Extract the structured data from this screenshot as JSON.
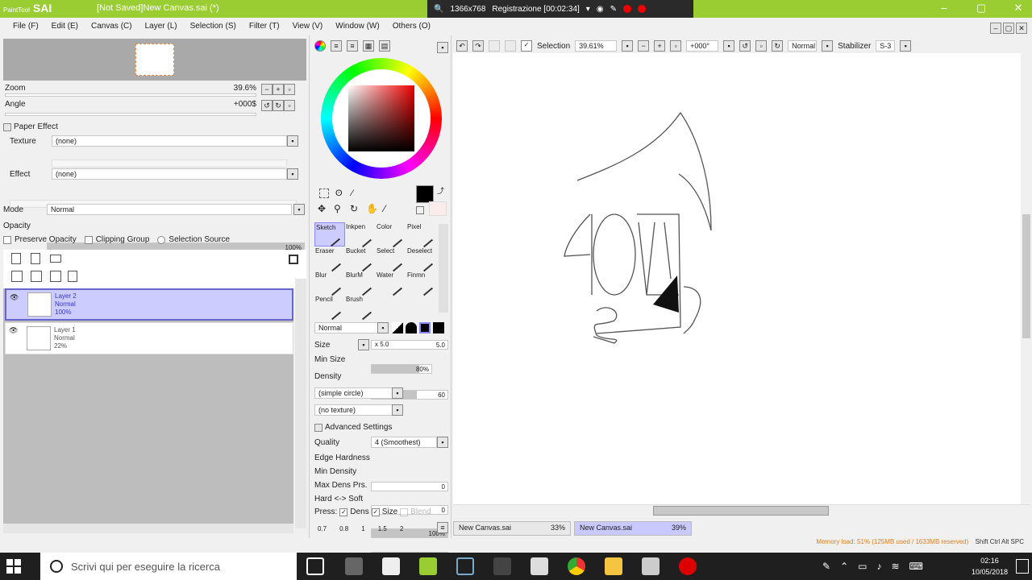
{
  "titlebar": {
    "logo_small": "PaintTool",
    "logo_big": "SAI",
    "title": "[Not Saved]New Canvas.sai (*)",
    "minimize": "–",
    "maximize": "▢",
    "close": "✕"
  },
  "recorder": {
    "resolution": "1366x768",
    "status": "Registrazione [00:02:34]"
  },
  "menu": [
    "File (F)",
    "Edit (E)",
    "Canvas (C)",
    "Layer (L)",
    "Selection (S)",
    "Filter (T)",
    "View (V)",
    "Window (W)",
    "Others (O)"
  ],
  "navigator": {
    "zoom_label": "Zoom",
    "zoom_value": "39.6%",
    "angle_label": "Angle",
    "angle_value": "+000$"
  },
  "paper_effect": {
    "header": "Paper Effect",
    "texture_label": "Texture",
    "texture_value": "(none)",
    "effect_label": "Effect",
    "effect_value": "(none)"
  },
  "layer_props": {
    "mode_label": "Mode",
    "mode_value": "Normal",
    "opacity_label": "Opacity",
    "opacity_value": "100%",
    "preserve_opacity": "Preserve Opacity",
    "clipping_group": "Clipping Group",
    "selection_source": "Selection Source"
  },
  "layers": [
    {
      "name": "Layer 2",
      "mode": "Normal",
      "opacity": "100%",
      "selected": true
    },
    {
      "name": "Layer 1",
      "mode": "Normal",
      "opacity": "22%",
      "selected": false
    }
  ],
  "tools": {
    "brushes": [
      [
        "Sketch",
        "Inkpen",
        "Color",
        "Pixel"
      ],
      [
        "Eraser",
        "Bucket",
        "Select",
        "Deselect"
      ],
      [
        "Blur",
        "BlurM",
        "Water",
        "Finmn"
      ],
      [
        "Pencil",
        "Brush",
        "",
        ""
      ]
    ],
    "blend_mode": "Normal",
    "size_label": "Size",
    "size_mult": "x 5.0",
    "size_value": "5.0",
    "minsize_label": "Min Size",
    "minsize_value": "80%",
    "density_label": "Density",
    "density_value": "60",
    "shape": "(simple circle)",
    "texture": "(no texture)",
    "advanced_header": "Advanced Settings",
    "quality_label": "Quality",
    "quality_value": "4 (Smoothest)",
    "edge_hardness_label": "Edge Hardness",
    "edge_hardness_value": "0",
    "min_density_label": "Min Density",
    "min_density_value": "0",
    "max_dens_label": "Max Dens Prs.",
    "max_dens_value": "100%",
    "hard_soft_label": "Hard <-> Soft",
    "hard_soft_value": "0",
    "press_label": "Press:",
    "press_dens": "Dens",
    "press_size": "Size",
    "press_blend": "Blend",
    "size_presets": [
      "0.7",
      "0.8",
      "1",
      "1.5",
      "2"
    ]
  },
  "toolbar": {
    "selection_label": "Selection",
    "zoom_value": "39.61%",
    "angle_value": "+000°",
    "blend": "Normal",
    "stabilizer_label": "Stabilizer",
    "stabilizer_value": "S-3"
  },
  "tabs": [
    {
      "name": "New Canvas.sai",
      "zoom": "33%"
    },
    {
      "name": "New Canvas.sai",
      "zoom": "39%"
    }
  ],
  "status": {
    "memory": "Memory load: 51% (125MB used / 1633MB reserved)",
    "keys": "Shift Ctrl Alt SPC"
  },
  "taskbar": {
    "search_placeholder": "Scrivi qui per eseguire la ricerca",
    "time": "02:16",
    "date": "10/05/2018"
  },
  "colors": {
    "title_green": "#9acd32",
    "selected_layer": "#ccccff",
    "taskbar": "#1f1f1f"
  }
}
